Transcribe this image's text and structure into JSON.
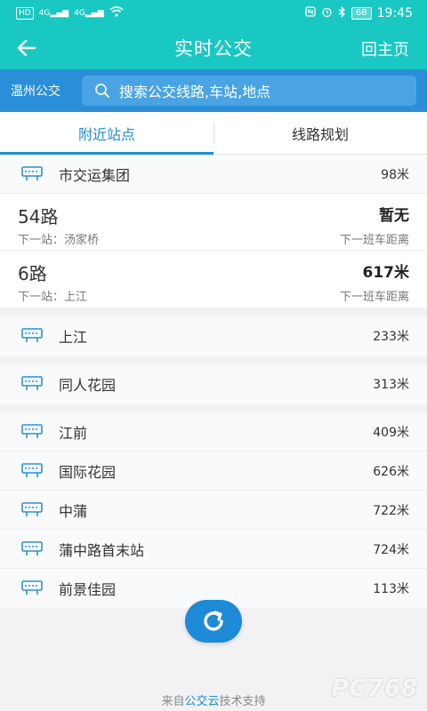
{
  "statusbar": {
    "time": "19:45",
    "battery": "68",
    "hd": "HD",
    "net1": "4G",
    "net2": "4G"
  },
  "header": {
    "title": "实时公交",
    "home": "回主页"
  },
  "search": {
    "city": "温州公交",
    "placeholder": "搜索公交线路,车站,地点"
  },
  "tabs": [
    {
      "label": "附近站点"
    },
    {
      "label": "线路规划"
    }
  ],
  "groups": [
    {
      "station": {
        "name": "市交运集团",
        "distance": "98米"
      },
      "routes": [
        {
          "name": "54路",
          "next": "下一站：汤家桥",
          "value": "暂无",
          "note": "下一班车距离"
        },
        {
          "name": "6路",
          "next": "下一站：上江",
          "value": "617米",
          "note": "下一班车距离"
        }
      ]
    },
    {
      "station": {
        "name": "上江",
        "distance": "233米"
      }
    },
    {
      "station": {
        "name": "同人花园",
        "distance": "313米"
      }
    }
  ],
  "stations": [
    {
      "name": "江前",
      "distance": "409米"
    },
    {
      "name": "国际花园",
      "distance": "626米"
    },
    {
      "name": "中蒲",
      "distance": "722米"
    },
    {
      "name": "蒲中路首末站",
      "distance": "724米"
    },
    {
      "name": "前景佳园",
      "distance": "113米"
    }
  ],
  "footer": {
    "prefix": "来自",
    "brand": "公交云",
    "suffix": "技术支持"
  },
  "watermark": "PC768",
  "colors": {
    "header": "#19c8c2",
    "search": "#2a8fd8",
    "accent": "#1f8ad6"
  }
}
